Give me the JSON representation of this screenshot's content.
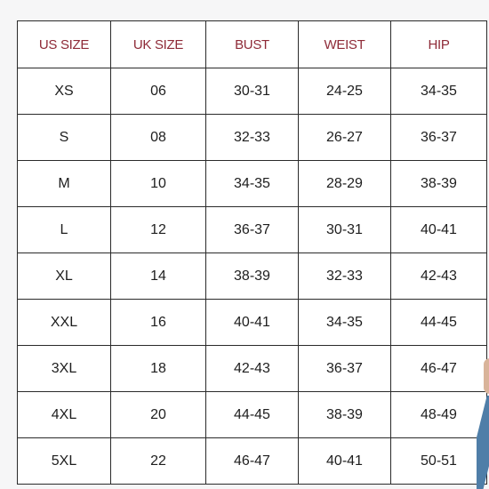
{
  "table": {
    "headers": [
      "US SIZE",
      "UK SIZE",
      "BUST",
      "WEIST",
      "HIP"
    ],
    "rows": [
      [
        "XS",
        "06",
        "30-31",
        "24-25",
        "34-35"
      ],
      [
        "S",
        "08",
        "32-33",
        "26-27",
        "36-37"
      ],
      [
        "M",
        "10",
        "34-35",
        "28-29",
        "38-39"
      ],
      [
        "L",
        "12",
        "36-37",
        "30-31",
        "40-41"
      ],
      [
        "XL",
        "14",
        "38-39",
        "32-33",
        "42-43"
      ],
      [
        "XXL",
        "16",
        "40-41",
        "34-35",
        "44-45"
      ],
      [
        "3XL",
        "18",
        "42-43",
        "36-37",
        "46-47"
      ],
      [
        "4XL",
        "20",
        "44-45",
        "38-39",
        "48-49"
      ],
      [
        "5XL",
        "22",
        "46-47",
        "40-41",
        "50-51"
      ]
    ]
  },
  "colors": {
    "header_text": "#8e2a37",
    "cell_text": "#1e1e1e",
    "border": "#2a2a2a",
    "background": "#f6f6f7"
  }
}
